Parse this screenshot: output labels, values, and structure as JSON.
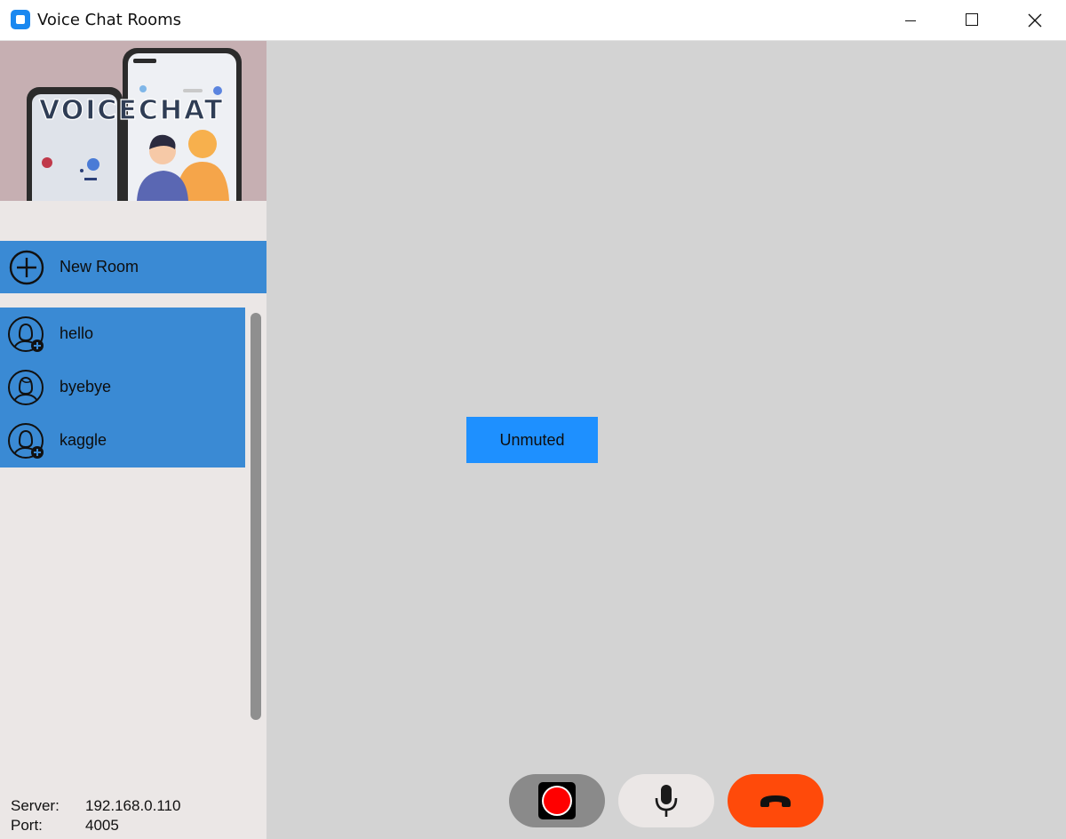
{
  "window": {
    "title": "Voice Chat Rooms",
    "controls": [
      "minimize",
      "maximize",
      "close"
    ]
  },
  "sidebar": {
    "banner": {
      "logo_text": "VOICECHAT",
      "icon": "voicechat-banner-illustration"
    },
    "new_room_label": "New Room",
    "new_room_icon": "plus-circle-icon",
    "rooms": [
      {
        "name": "hello",
        "icon": "user-add-icon"
      },
      {
        "name": "byebye",
        "icon": "user-icon"
      },
      {
        "name": "kaggle",
        "icon": "user-add-icon"
      }
    ],
    "server_label": "Server:",
    "server_value": "192.168.0.110",
    "port_label": "Port:",
    "port_value": "4005"
  },
  "main": {
    "mute_status_label": "Unmuted",
    "controls": {
      "record_icon": "record-icon",
      "mic_icon": "microphone-icon",
      "hangup_icon": "hang-up-icon"
    }
  },
  "colors": {
    "accent_blue": "#3a8ad4",
    "status_blue": "#1e90ff",
    "hangup_orange": "#ff4a0a",
    "record_red": "#ff0000",
    "main_bg": "#d3d3d3",
    "sidebar_bg": "#ebe7e6"
  }
}
